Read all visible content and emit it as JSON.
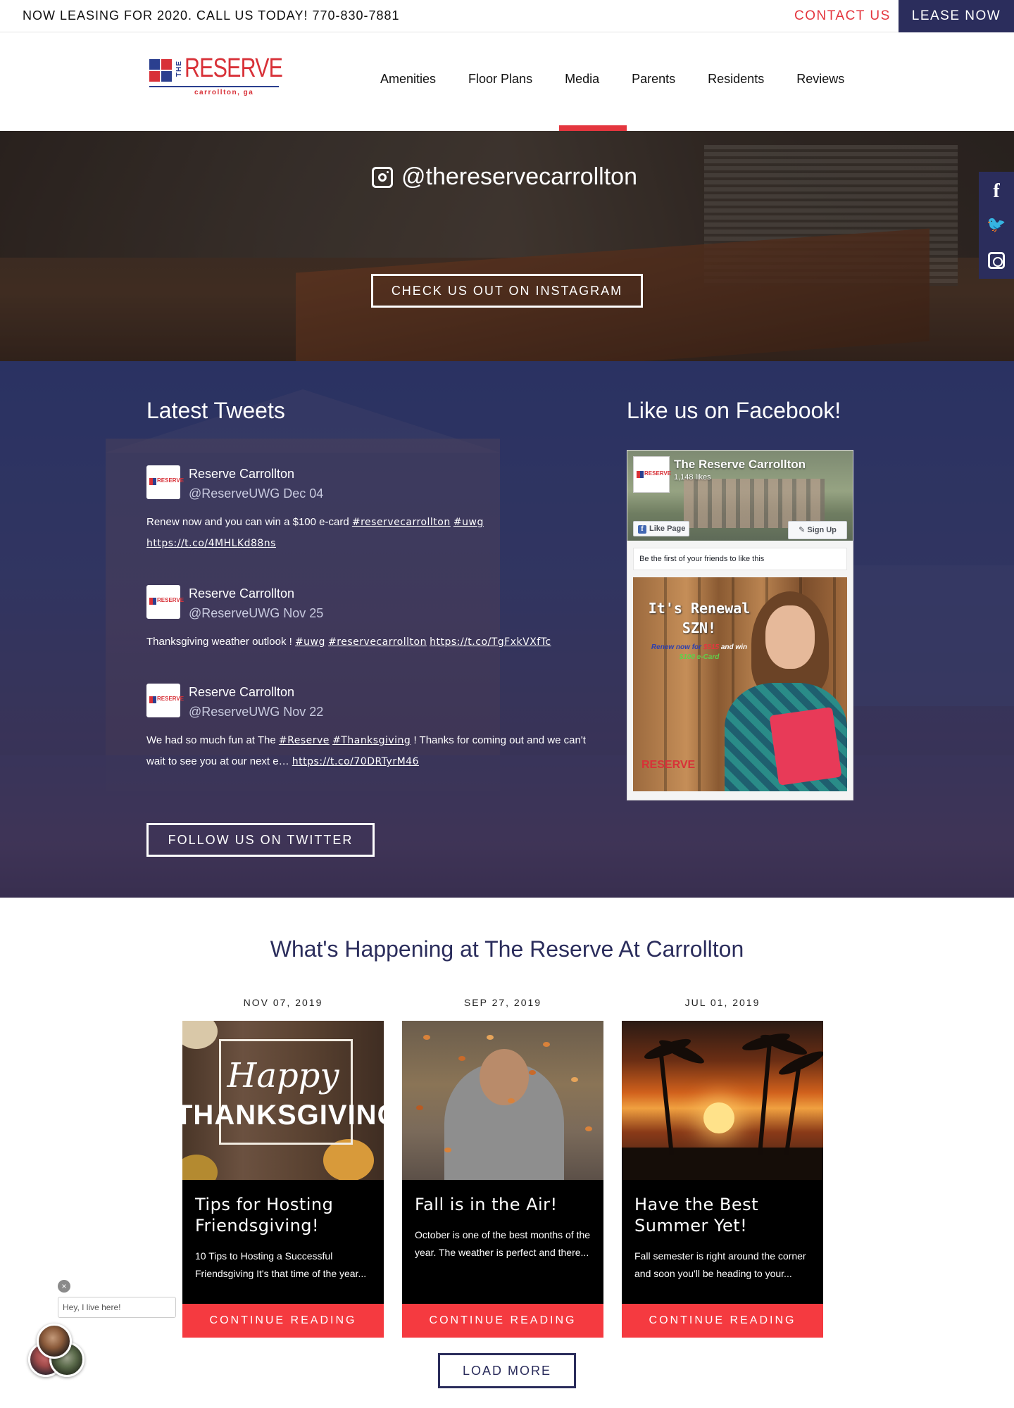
{
  "topbar": {
    "leasing_text": "NOW LEASING FOR 2020. CALL US TODAY! 770-830-7881",
    "contact_label": "CONTACT US",
    "lease_label": "LEASE NOW"
  },
  "logo": {
    "the": "THE",
    "name": "RESERVE",
    "city": "carrollton, ga"
  },
  "nav": {
    "items": [
      "Amenities",
      "Floor Plans",
      "Media",
      "Parents",
      "Residents",
      "Reviews"
    ],
    "active": "Media"
  },
  "instagram": {
    "handle": "@thereservecarrollton",
    "button": "CHECK US OUT ON INSTAGRAM"
  },
  "social": {
    "facebook": "f",
    "twitter": "🐦"
  },
  "tweets": {
    "heading": "Latest Tweets",
    "items": [
      {
        "name": "Reserve Carrollton",
        "user": "@ReserveUWG Dec 04",
        "text_parts": [
          "Renew now and you can win a $100 e-card ",
          "#reservecarrollton",
          " ",
          "#uwg",
          " ",
          "https://t.co/4MHLKd88ns"
        ]
      },
      {
        "name": "Reserve Carrollton",
        "user": "@ReserveUWG Nov 25",
        "text_parts": [
          "Thanksgiving weather outlook ! ",
          "#uwg",
          " ",
          "#reservecarrollton",
          " ",
          "https://t.co/TgFxkVXfTc"
        ]
      },
      {
        "name": "Reserve Carrollton",
        "user": "@ReserveUWG Nov 22",
        "text_parts": [
          "We had so much fun at The ",
          "#Reserve",
          " ",
          "#Thanksgiving",
          " ! Thanks for coming out and we can't wait to see you at our next e… ",
          "https://t.co/70DRTyrM46"
        ]
      }
    ],
    "follow_button": "FOLLOW US ON TWITTER"
  },
  "facebook": {
    "heading": "Like us on Facebook!",
    "page_name": "The Reserve Carrollton",
    "likes": "1,148 likes",
    "like_page": "Like Page",
    "sign_up": "✎ Sign Up",
    "first_like": "Be the first of your friends to like this",
    "post": {
      "headline": "It's Renewal SZN!",
      "promo_line_1a": "Renew now for ",
      "promo_line_1b": "$515",
      "promo_line_1c": " and win",
      "promo_line_2": "$100 e-Card",
      "brand": "RESERVE"
    }
  },
  "happening": {
    "title": "What's Happening at The Reserve At Carrollton",
    "posts": [
      {
        "date": "NOV 07, 2019",
        "img_happy": "Happy",
        "img_thanks": "THANKSGIVING",
        "title": "Tips for Hosting Friendsgiving!",
        "excerpt": "10 Tips to Hosting a Successful Friendsgiving   It's that time of the year...",
        "button": "CONTINUE READING"
      },
      {
        "date": "SEP 27, 2019",
        "title": "Fall is in the Air!",
        "excerpt": "October is one of the best months of the year. The weather is perfect and there...",
        "button": "CONTINUE READING"
      },
      {
        "date": "JUL 01, 2019",
        "title": "Have the Best Summer Yet!",
        "excerpt": "Fall semester is right around the corner and soon you'll be heading to your...",
        "button": "CONTINUE READING"
      }
    ],
    "load_more": "LOAD MORE"
  },
  "chat": {
    "close": "×",
    "message": "Hey, I live here!"
  },
  "colors": {
    "navy": "#2b2d5c",
    "accent_red": "#e4363e",
    "button_red": "#f53a40"
  }
}
